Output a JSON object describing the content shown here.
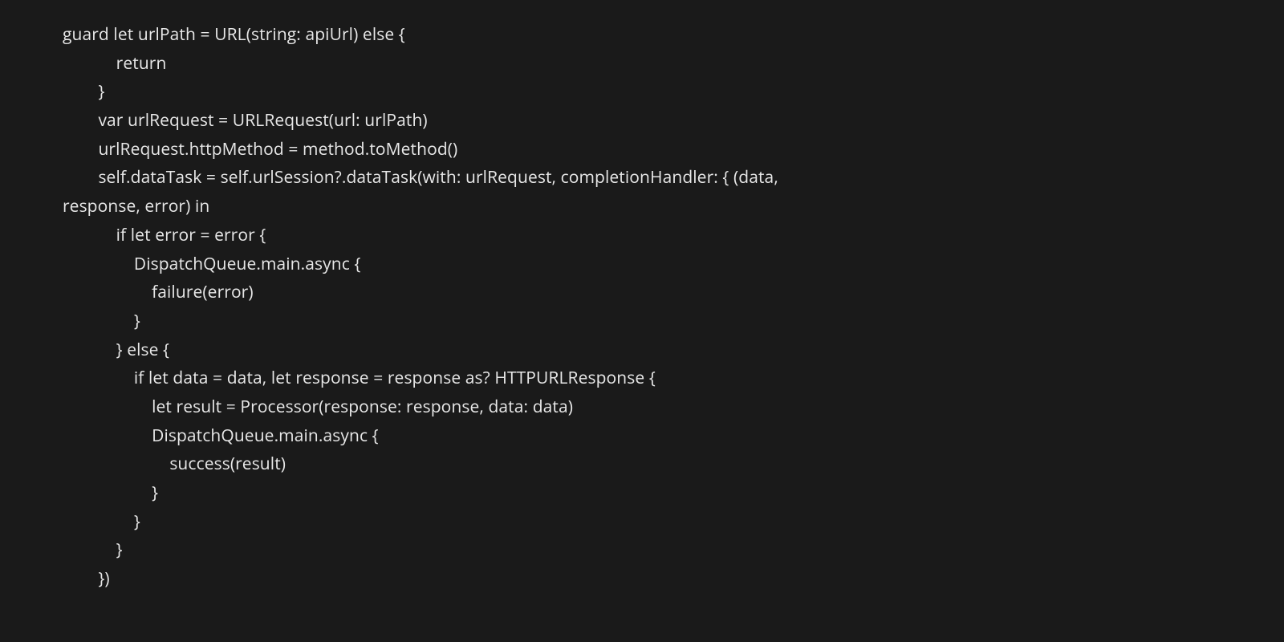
{
  "code": {
    "lines": [
      "guard let urlPath = URL(string: apiUrl) else {",
      "            return",
      "        }",
      "        var urlRequest = URLRequest(url: urlPath)",
      "        urlRequest.httpMethod = method.toMethod()",
      "        self.dataTask = self.urlSession?.dataTask(with: urlRequest, completionHandler: { (data,",
      "response, error) in",
      "            if let error = error {",
      "                DispatchQueue.main.async {",
      "                    failure(error)",
      "                }",
      "            } else {",
      "                if let data = data, let response = response as? HTTPURLResponse {",
      "                    let result = Processor(response: response, data: data)",
      "                    DispatchQueue.main.async {",
      "                        success(result)",
      "                    }",
      "                }",
      "            }",
      "        })"
    ]
  }
}
